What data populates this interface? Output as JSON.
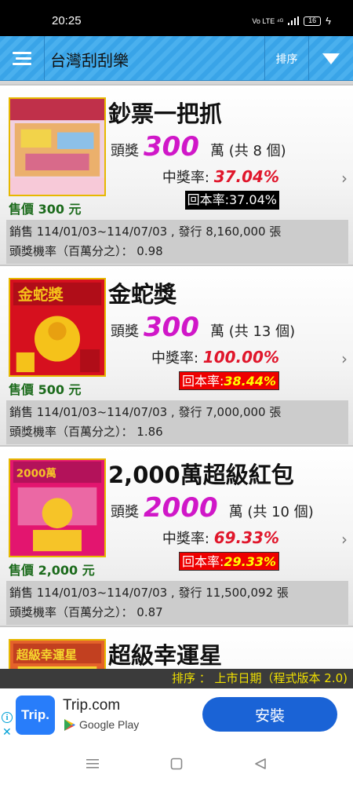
{
  "status_bar": {
    "time": "20:25",
    "network": "Vo LTE ⁴ᴳ",
    "battery": "16"
  },
  "app_bar": {
    "title": "台灣刮刮樂",
    "sort_label": "排序"
  },
  "tickets": [
    {
      "name": "鈔票一把抓",
      "prize_label": "頭獎",
      "prize_amount": "300",
      "prize_unit": "萬 (共 8 個)",
      "win_rate_label": "中獎率:",
      "win_rate": "37.04%",
      "return_label": "回本率:",
      "return_rate": "37.04%",
      "return_style": "black",
      "price": "售價 300 元",
      "sale_line": "銷售 114/01/03~114/07/03 , 發行 8,160,000 張",
      "odds_line": "頭獎機率（百萬分之）： 0.98",
      "thumb_colors": [
        "#e8a23a",
        "#c0304a",
        "#f2d34a"
      ]
    },
    {
      "name": "金蛇獎",
      "prize_label": "頭獎",
      "prize_amount": "300",
      "prize_unit": "萬 (共 13 個)",
      "win_rate_label": "中獎率:",
      "win_rate": "100.00%",
      "return_label": "回本率:",
      "return_rate": "38.44%",
      "return_style": "red",
      "price": "售價 500 元",
      "sale_line": "銷售 114/01/03~114/07/03 , 發行 7,000,000 張",
      "odds_line": "頭獎機率（百萬分之）： 1.86",
      "thumb_colors": [
        "#d6101e",
        "#f5c21a",
        "#b00d18"
      ]
    },
    {
      "name": "2,000萬超級紅包",
      "prize_label": "頭獎",
      "prize_amount": "2000",
      "prize_unit": "萬 (共 10 個)",
      "win_rate_label": "中獎率:",
      "win_rate": "69.33%",
      "return_label": "回本率:",
      "return_rate": "29.33%",
      "return_style": "red",
      "price": "售價 2,000 元",
      "sale_line": "銷售 114/01/03~114/07/03 , 發行 11,500,092 張",
      "odds_line": "頭獎機率（百萬分之）： 0.87",
      "thumb_colors": [
        "#e3156f",
        "#f6c428",
        "#b3125a"
      ]
    },
    {
      "name": "超級幸運星",
      "thumb_colors": [
        "#e4622a",
        "#f6d62e",
        "#c24020"
      ]
    }
  ],
  "sort_info": "排序 ： 上市日期（程式版本 2.0)",
  "ad": {
    "logo_text": "Trip.",
    "app_name": "Trip.com",
    "store": "Google Play",
    "install_label": "安裝",
    "info_glyph": "i",
    "close_glyph": "✕"
  },
  "colors": {
    "app_bar": "#39a4e8",
    "prize": "#d017c8",
    "rate": "#e0162b",
    "price": "#1c6b1c",
    "install": "#1a63d6"
  }
}
